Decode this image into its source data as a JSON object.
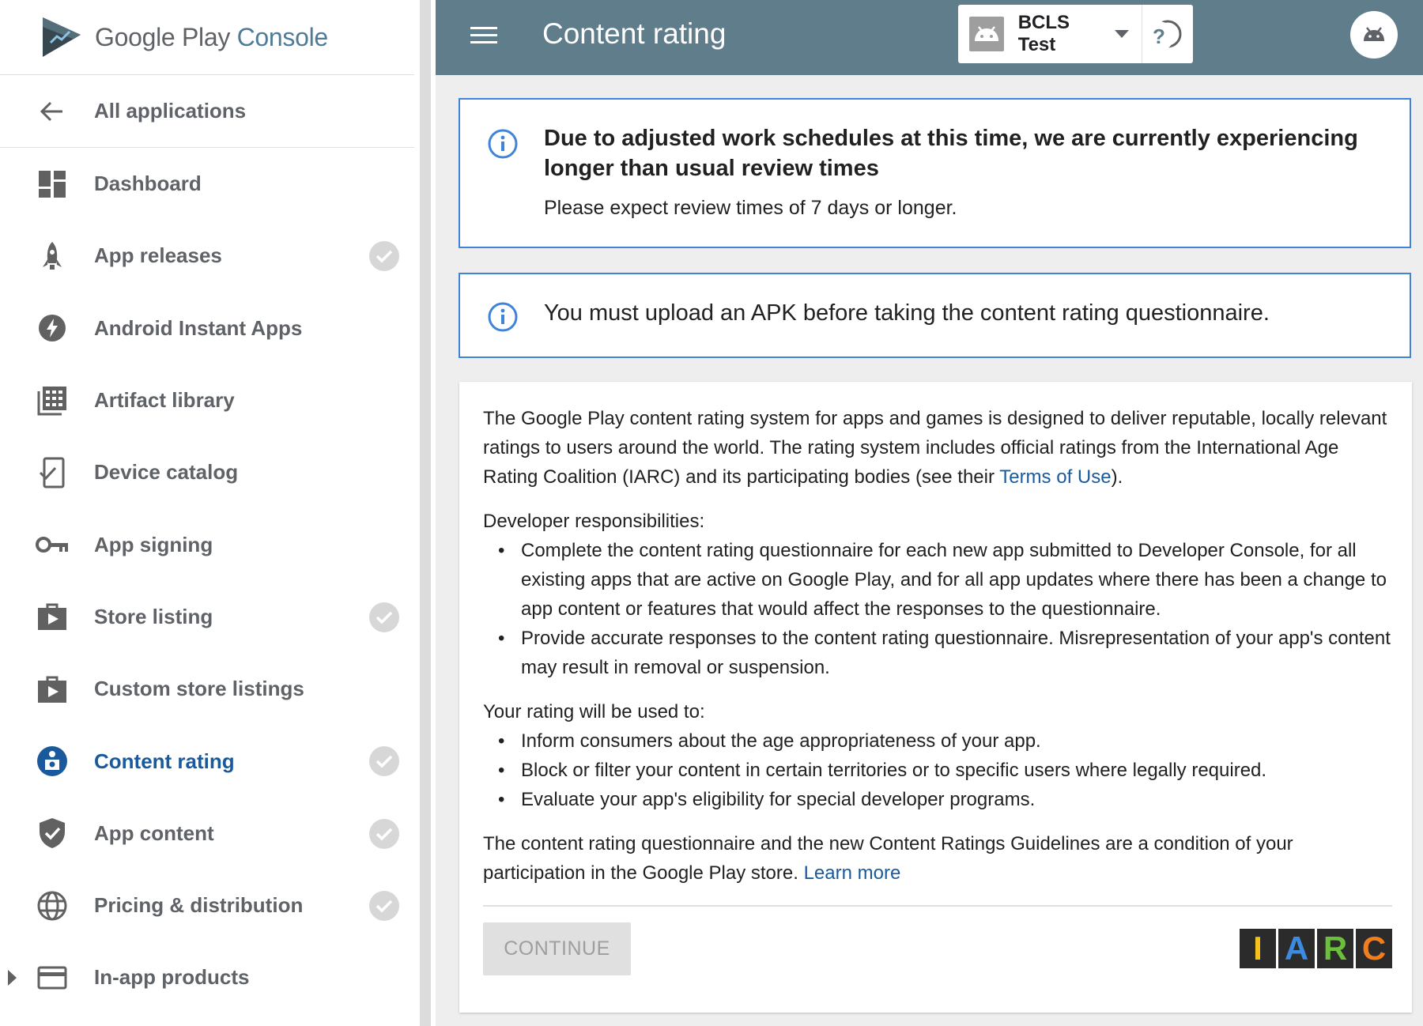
{
  "brand": {
    "google_play": "Google Play",
    "console": "Console"
  },
  "sidebar": {
    "back_label": "All applications",
    "items": [
      {
        "label": "Dashboard",
        "icon": "dashboard-icon",
        "checked": false
      },
      {
        "label": "App releases",
        "icon": "rocket-icon",
        "checked": true
      },
      {
        "label": "Android Instant Apps",
        "icon": "bolt-icon",
        "checked": false
      },
      {
        "label": "Artifact library",
        "icon": "library-icon",
        "checked": false
      },
      {
        "label": "Device catalog",
        "icon": "device-check-icon",
        "checked": false
      },
      {
        "label": "App signing",
        "icon": "key-icon",
        "checked": false
      },
      {
        "label": "Store listing",
        "icon": "store-bag-icon",
        "checked": true
      },
      {
        "label": "Custom store listings",
        "icon": "store-bag-icon",
        "checked": false
      },
      {
        "label": "Content rating",
        "icon": "content-rating-icon",
        "checked": true,
        "active": true
      },
      {
        "label": "App content",
        "icon": "shield-check-icon",
        "checked": true
      },
      {
        "label": "Pricing & distribution",
        "icon": "globe-icon",
        "checked": true
      },
      {
        "label": "In-app products",
        "icon": "credit-card-icon",
        "checked": false,
        "expandable": true
      }
    ]
  },
  "topbar": {
    "title": "Content rating",
    "app_name": "BCLS Test",
    "icons": [
      "menu-icon",
      "info-icon",
      "bell-icon",
      "help-icon",
      "android-avatar-icon"
    ]
  },
  "notice1": {
    "title": "Due to adjusted work schedules at this time, we are currently experiencing longer than usual review times",
    "sub": "Please expect review times of 7 days or longer."
  },
  "notice2": {
    "message": "You must upload an APK before taking the content rating questionnaire."
  },
  "card": {
    "intro_before": "The Google Play content rating system for apps and games is designed to deliver reputable, locally relevant ratings to users around the world. The rating system includes official ratings from the International Age Rating Coalition (IARC) and its participating bodies (see their ",
    "intro_link": "Terms of Use",
    "intro_after": ").",
    "dev_heading": "Developer responsibilities:",
    "dev_items": [
      "Complete the content rating questionnaire for each new app submitted to Developer Console, for all existing apps that are active on Google Play, and for all app updates where there has been a change to app content or features that would affect the responses to the questionnaire.",
      "Provide accurate responses to the content rating questionnaire. Misrepresentation of your app's content may result in removal or suspension."
    ],
    "use_heading": "Your rating will be used to:",
    "use_items": [
      "Inform consumers about the age appropriateness of your app.",
      "Block or filter your content in certain territories or to specific users where legally required.",
      "Evaluate your app's eligibility for special developer programs."
    ],
    "footer_text": "The content rating questionnaire and the new Content Ratings Guidelines are a condition of your participation in the Google Play store. ",
    "footer_link": "Learn more",
    "continue_label": "CONTINUE",
    "iarc_letters": [
      "I",
      "A",
      "R",
      "C"
    ],
    "iarc_colors": [
      "#f5c21b",
      "#3d8be0",
      "#6cbf3a",
      "#f07d1e"
    ]
  },
  "colors": {
    "topbar": "#607d8b",
    "accent": "#1a5a9c",
    "notice_border": "#3f84d8"
  }
}
